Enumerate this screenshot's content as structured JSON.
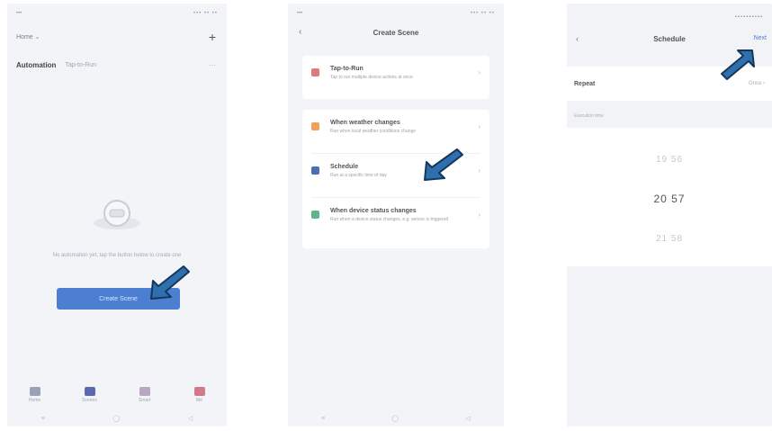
{
  "colors": {
    "accent": "#4c7fd1",
    "arrow": "#2f6fae",
    "arrow_outline": "#15375c"
  },
  "phone1": {
    "status": {
      "left": "•••",
      "right": "••• •• ••"
    },
    "home_label": "Home ⌄",
    "tabs": {
      "active": "Automation",
      "other": "Tap-to-Run"
    },
    "empty_text": "No automation yet, tap the button below to create one",
    "create_button": "Create Scene",
    "nav": [
      {
        "label": "Home",
        "color": "#9aa3b6"
      },
      {
        "label": "Scenes",
        "color": "#5b6ab0"
      },
      {
        "label": "Smart",
        "color": "#b7a7c0"
      },
      {
        "label": "Me",
        "color": "#d27a87"
      }
    ],
    "sys_nav": [
      "≡",
      "◯",
      "◁"
    ]
  },
  "phone2": {
    "status": {
      "left": "•••",
      "right": "••• •• ••"
    },
    "back": "‹",
    "title": "Create Scene",
    "options": [
      {
        "title": "Tap-to-Run",
        "desc": "Tap to run multiple device actions at once",
        "color": "#e07a7a"
      },
      {
        "title": "When weather changes",
        "desc": "Run when local weather conditions change",
        "color": "#f0a25a"
      },
      {
        "title": "Schedule",
        "desc": "Run at a specific time of day",
        "color": "#4a6fb5"
      },
      {
        "title": "When device status changes",
        "desc": "Run when a device status changes, e.g. sensor is triggered",
        "color": "#5fb58a"
      }
    ],
    "chevron": "›",
    "sys_nav": [
      "≡",
      "◯",
      "◁"
    ]
  },
  "phone3": {
    "status": {
      "right": "▪▪▪▪▪▪▪▪▪▪"
    },
    "back": "‹",
    "title": "Schedule",
    "next": "Next",
    "repeat_label": "Repeat",
    "repeat_value": "Once ›",
    "section_label": "Execution time",
    "times": [
      "19 56",
      "20 57",
      "21 58"
    ]
  }
}
